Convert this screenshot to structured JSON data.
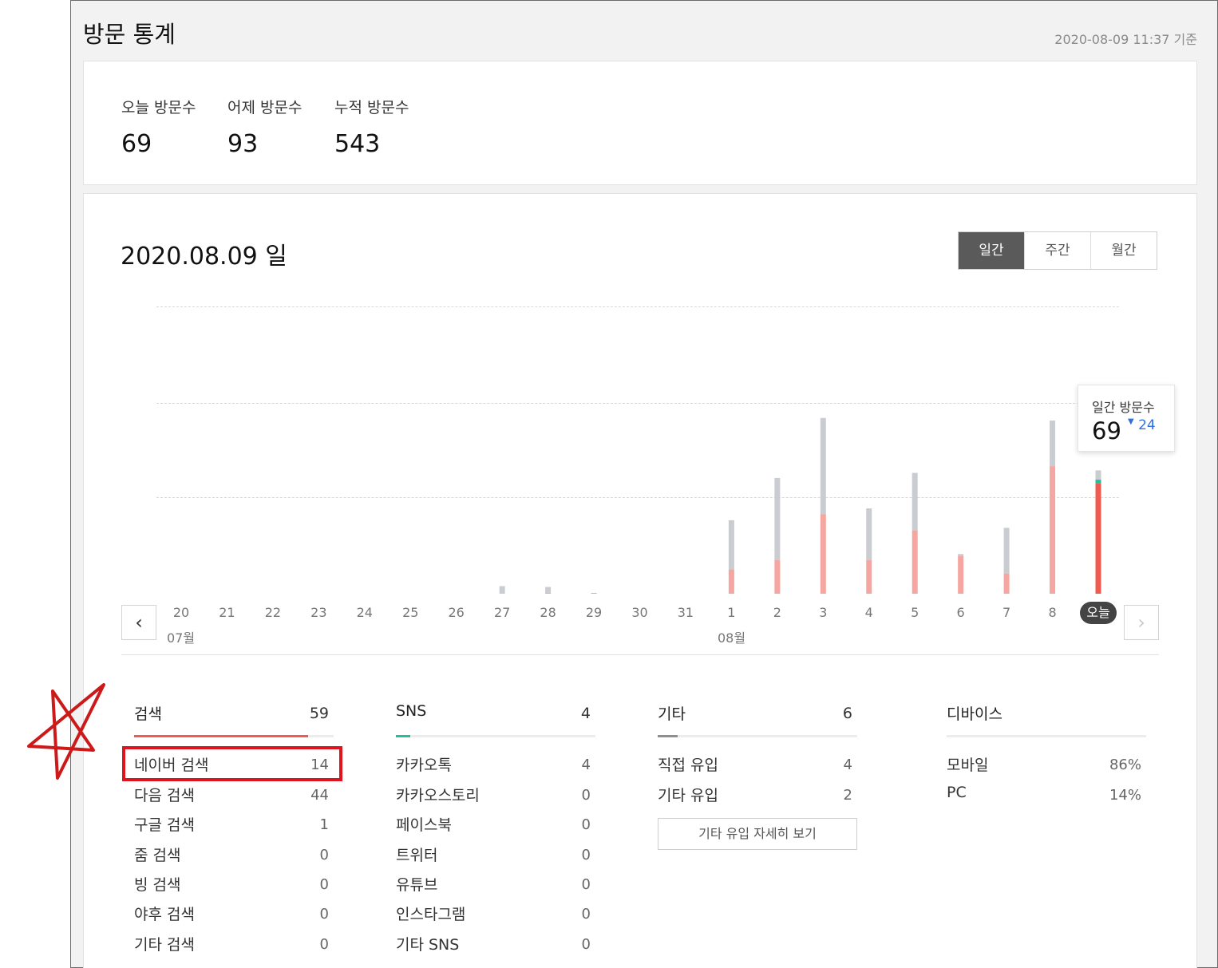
{
  "header": {
    "title": "방문 통계",
    "updated": "2020-08-09 11:37 기준"
  },
  "summary": [
    {
      "label": "오늘 방문수",
      "value": "69"
    },
    {
      "label": "어제 방문수",
      "value": "93"
    },
    {
      "label": "누적 방문수",
      "value": "543"
    }
  ],
  "chart": {
    "date_title": "2020.08.09 일",
    "tabs": [
      {
        "label": "일간",
        "active": true
      },
      {
        "label": "주간",
        "active": false
      },
      {
        "label": "월간",
        "active": false
      }
    ],
    "prev_icon": "chevron-left-icon",
    "next_icon": "chevron-right-icon",
    "month_labels": [
      "07월",
      "08월"
    ],
    "tooltip": {
      "label": "일간 방문수",
      "value": "69",
      "diff": "24",
      "diff_icon": "triangle-down-icon"
    }
  },
  "chart_data": {
    "type": "bar",
    "categories": [
      "20",
      "21",
      "22",
      "23",
      "24",
      "25",
      "26",
      "27",
      "28",
      "29",
      "30",
      "31",
      "1",
      "2",
      "3",
      "4",
      "5",
      "6",
      "7",
      "8",
      "오늘"
    ],
    "series": [
      {
        "name": "검색",
        "color": "#f6a6a0",
        "values": [
          0,
          0,
          0,
          0,
          0,
          0,
          0,
          0,
          1,
          1,
          0,
          0,
          29,
          40,
          94,
          40,
          75,
          45,
          24,
          151,
          131
        ]
      },
      {
        "name": "SNS",
        "color": "#1fbf9f",
        "values": [
          0,
          0,
          0,
          0,
          0,
          0,
          0,
          0,
          0,
          0,
          0,
          0,
          0,
          0,
          0,
          0,
          0,
          0,
          0,
          0,
          4
        ]
      },
      {
        "name": "기타",
        "color": "#c9cdd2",
        "values": [
          0,
          0,
          0,
          0,
          0,
          0,
          0,
          9,
          7,
          0,
          0,
          0,
          58,
          97,
          114,
          61,
          68,
          2,
          54,
          54,
          11
        ]
      }
    ],
    "today_color": "#f05a4f",
    "ylim": [
      0,
      340
    ]
  },
  "columns": [
    {
      "title": "검색",
      "total": "59",
      "color": "#f05a4f",
      "fill_fraction": 0.87,
      "rows": [
        {
          "label": "네이버 검색",
          "value": "14"
        },
        {
          "label": "다음 검색",
          "value": "44"
        },
        {
          "label": "구글 검색",
          "value": "1"
        },
        {
          "label": "줌 검색",
          "value": "0"
        },
        {
          "label": "빙 검색",
          "value": "0"
        },
        {
          "label": "야후 검색",
          "value": "0"
        },
        {
          "label": "기타 검색",
          "value": "0"
        }
      ]
    },
    {
      "title": "SNS",
      "total": "4",
      "color": "#1fbf9f",
      "fill_fraction": 0.07,
      "rows": [
        {
          "label": "카카오톡",
          "value": "4"
        },
        {
          "label": "카카오스토리",
          "value": "0"
        },
        {
          "label": "페이스북",
          "value": "0"
        },
        {
          "label": "트위터",
          "value": "0"
        },
        {
          "label": "유튜브",
          "value": "0"
        },
        {
          "label": "인스타그램",
          "value": "0"
        },
        {
          "label": "기타 SNS",
          "value": "0"
        }
      ]
    },
    {
      "title": "기타",
      "total": "6",
      "color": "#8f8f8f",
      "fill_fraction": 0.1,
      "rows": [
        {
          "label": "직접 유입",
          "value": "4"
        },
        {
          "label": "기타 유입",
          "value": "2"
        }
      ],
      "button": "기타 유입 자세히 보기"
    },
    {
      "title": "디바이스",
      "total": "",
      "color": "#cccccc",
      "fill_fraction": 0,
      "rows": [
        {
          "label": "모바일",
          "value": "86%"
        },
        {
          "label": "PC",
          "value": "14%"
        }
      ]
    }
  ],
  "annotation": {
    "star_color": "#cc1a1a",
    "box_color": "#e0141e"
  }
}
